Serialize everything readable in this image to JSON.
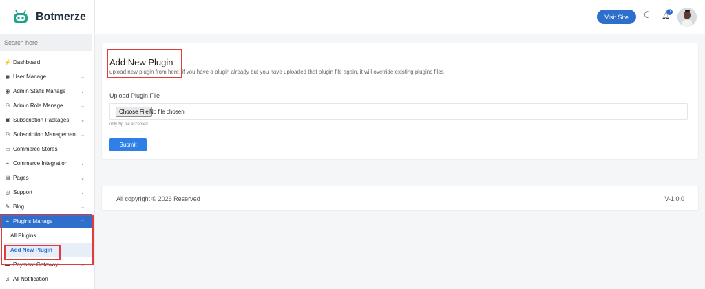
{
  "brand": {
    "name": "Botmerze",
    "color": "#1fa38a"
  },
  "search": {
    "placeholder": "Search here"
  },
  "sidebar": {
    "items": [
      {
        "label": "Dashboard",
        "icon": "dashboard-icon",
        "glyph": "⚡",
        "has_children": false
      },
      {
        "label": "User Manage",
        "icon": "user-icon",
        "glyph": "◉",
        "has_children": true
      },
      {
        "label": "Admin Staffs Manage",
        "icon": "user-icon",
        "glyph": "◉",
        "has_children": true
      },
      {
        "label": "Admin Role Manage",
        "icon": "users-icon",
        "glyph": "⚇",
        "has_children": true
      },
      {
        "label": "Subscription Packages",
        "icon": "box-icon",
        "glyph": "▣",
        "has_children": true
      },
      {
        "label": "Subscription Management",
        "icon": "users-icon",
        "glyph": "⚇",
        "has_children": true
      },
      {
        "label": "Commerce Stores",
        "icon": "store-icon",
        "glyph": "▭",
        "has_children": false
      },
      {
        "label": "Commerce Integration",
        "icon": "plug-icon",
        "glyph": "⌁",
        "has_children": true
      },
      {
        "label": "Pages",
        "icon": "page-icon",
        "glyph": "▤",
        "has_children": true
      },
      {
        "label": "Support",
        "icon": "support-icon",
        "glyph": "◎",
        "has_children": true
      },
      {
        "label": "Blog",
        "icon": "blog-icon",
        "glyph": "✎",
        "has_children": true
      },
      {
        "label": "Plugins Manage",
        "icon": "plugin-icon",
        "glyph": "⌁",
        "has_children": true,
        "active": true
      }
    ],
    "plugins_sub": [
      {
        "label": "All Plugins"
      },
      {
        "label": "Add New Plugin",
        "current": true
      }
    ],
    "after": [
      {
        "label": "Payment Gateway",
        "icon": "payment-icon",
        "glyph": "▬",
        "has_children": true
      },
      {
        "label": "All Notification",
        "icon": "bell-icon",
        "glyph": "♫",
        "has_children": false
      }
    ]
  },
  "topbar": {
    "visit_label": "Visit Site",
    "notification_count": "0",
    "accent": "#2e6fcc"
  },
  "page": {
    "title": "Add New Plugin",
    "description": "upload new plugin from here. if you have a plugin already but you have uploaded that plugin file again, it will override existing plugins files",
    "field_label": "Upload Plugin File",
    "file_button": "Choose File",
    "file_status": "No file chosen",
    "hint": "only zip file accepted",
    "submit_label": "Submit"
  },
  "footer": {
    "copyright": "All copyright © 2026 Reserved",
    "version": "V-1.0.0"
  }
}
